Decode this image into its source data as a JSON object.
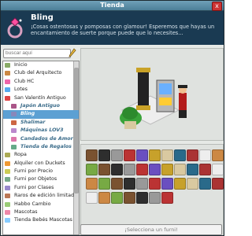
{
  "window": {
    "title": "Tienda",
    "close": "x"
  },
  "header": {
    "title": "Bling",
    "description": "¡Cosas ostentosas y pomposas con glamour! Esperemos que hayas un encantamiento de suerte porque puede que lo necesites..."
  },
  "search": {
    "placeholder": "buscar aquí"
  },
  "categories": [
    {
      "label": "Inicio",
      "icon": "home-icon",
      "level": 0
    },
    {
      "label": "Club del Arquitecto",
      "icon": "architect-icon",
      "level": 0
    },
    {
      "label": "Club HC",
      "icon": "hc-icon",
      "level": 0
    },
    {
      "label": "Lotes",
      "icon": "package-icon",
      "level": 0
    },
    {
      "label": "San Valentín Antiguo",
      "icon": "heart-icon",
      "level": 0
    },
    {
      "label": "Japón Antiguo",
      "icon": "lantern-icon",
      "level": 1
    },
    {
      "label": "Bling",
      "icon": "ring-icon",
      "level": 1,
      "selected": true
    },
    {
      "label": "Shalimar",
      "icon": "lamp-icon",
      "level": 1
    },
    {
      "label": "Máquinas LOV3",
      "icon": "machine-icon",
      "level": 1
    },
    {
      "label": "Candados de Amor",
      "icon": "lock-icon",
      "level": 1
    },
    {
      "label": "Tienda de Regalos",
      "icon": "gift-icon",
      "level": 1
    },
    {
      "label": "Ropa",
      "icon": "clothes-icon",
      "level": 0
    },
    {
      "label": "Alquiler con Duckets",
      "icon": "duck-icon",
      "level": 0
    },
    {
      "label": "Furni por Precio",
      "icon": "price-icon",
      "level": 0
    },
    {
      "label": "Furni por Objetos",
      "icon": "object-icon",
      "level": 0
    },
    {
      "label": "Furni por Clases",
      "icon": "class-icon",
      "level": 0
    },
    {
      "label": "Raros de edición limitad",
      "icon": "rare-icon",
      "level": 0
    },
    {
      "label": "Habbo Cambio",
      "icon": "exchange-icon",
      "level": 0
    },
    {
      "label": "Mascotas",
      "icon": "pet-icon",
      "level": 0
    },
    {
      "label": "Tienda Bebés Mascotas",
      "icon": "baby-pet-icon",
      "level": 0
    }
  ],
  "footer": {
    "select_label": "¡Selecciona un furni!"
  },
  "colors": {
    "header_bg": "#1a3a52",
    "selected_bg": "#5ca0d3",
    "titlebar": "#4c7f98"
  }
}
